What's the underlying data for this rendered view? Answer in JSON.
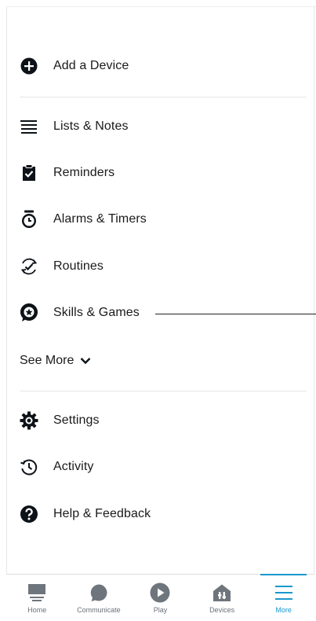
{
  "menu": {
    "add_device": "Add a Device",
    "items": [
      {
        "label": "Lists & Notes",
        "icon": "list-icon"
      },
      {
        "label": "Reminders",
        "icon": "clipboard-check-icon"
      },
      {
        "label": "Alarms & Timers",
        "icon": "alarm-clock-icon"
      },
      {
        "label": "Routines",
        "icon": "routine-check-icon"
      },
      {
        "label": "Skills & Games",
        "icon": "skills-bubble-icon"
      }
    ],
    "see_more": "See More",
    "bottom_items": [
      {
        "label": "Settings",
        "icon": "gear-icon"
      },
      {
        "label": "Activity",
        "icon": "history-icon"
      },
      {
        "label": "Help & Feedback",
        "icon": "help-icon"
      }
    ]
  },
  "tabs": [
    {
      "label": "Home",
      "icon": "home-icon"
    },
    {
      "label": "Communicate",
      "icon": "chat-bubble-icon"
    },
    {
      "label": "Play",
      "icon": "play-icon"
    },
    {
      "label": "Devices",
      "icon": "devices-house-icon"
    },
    {
      "label": "More",
      "icon": "hamburger-icon",
      "active": true
    }
  ],
  "colors": {
    "accent": "#1a98cd",
    "text": "#1a1a1a",
    "icon": "#232f3e"
  }
}
